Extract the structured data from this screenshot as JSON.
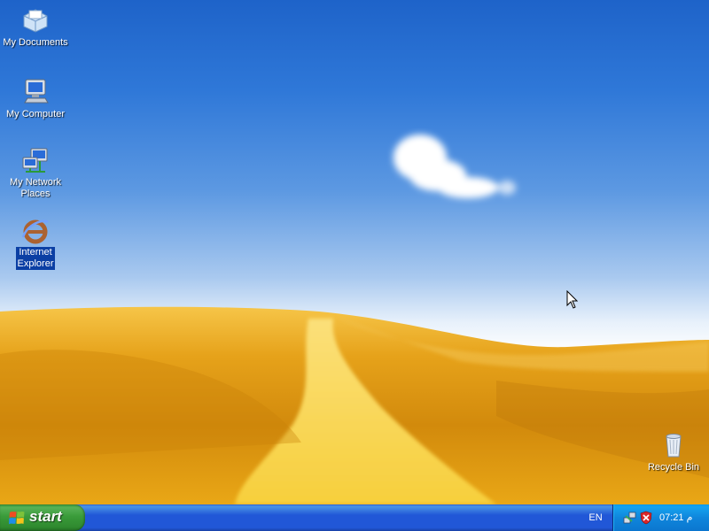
{
  "desktop": {
    "icons": [
      {
        "label": "My Documents",
        "icon": "my-documents-icon"
      },
      {
        "label": "My Computer",
        "icon": "my-computer-icon"
      },
      {
        "label": "My Network Places",
        "icon": "network-places-icon"
      },
      {
        "label": "Internet Explorer",
        "icon": "internet-explorer-icon",
        "selected": true
      },
      {
        "label": "Recycle Bin",
        "icon": "recycle-bin-icon"
      }
    ]
  },
  "taskbar": {
    "start_label": "start",
    "language": "EN",
    "tray": {
      "icons": [
        "network-tray-icon",
        "security-shield-icon"
      ],
      "clock": "07:21 م"
    },
    "colors": {
      "taskbar_blue": "#2157d7",
      "start_green": "#3a9b3a",
      "tray_blue": "#0f86dc"
    }
  }
}
